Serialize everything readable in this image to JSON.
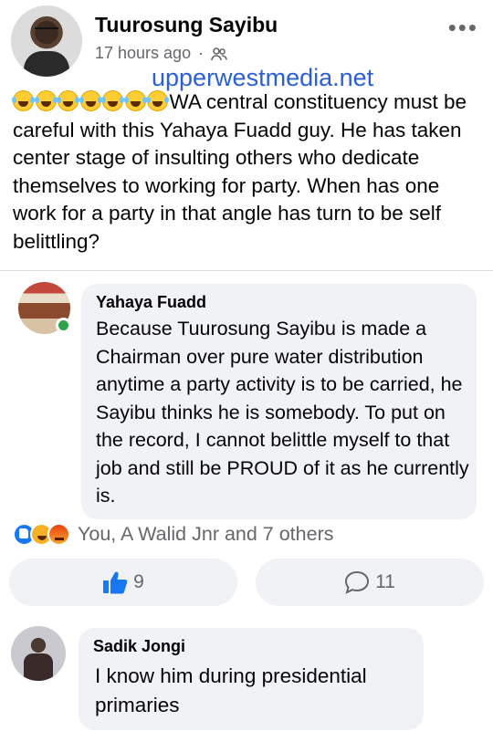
{
  "post": {
    "author": "Tuurosung Sayibu",
    "time": "17 hours ago",
    "separator": "·",
    "audience_icon": "friends-icon",
    "more_label": "•••",
    "watermark": "upperwestmedia.net",
    "emoji_count": 7,
    "emoji_icon": "tears-of-joy-emoji",
    "text": "WA central constituency must be careful with this Yahaya Fuadd guy. He has taken center stage  of insulting others who dedicate themselves to working for party. When has one work for a party in that angle has turn to be self belittling?"
  },
  "comment1": {
    "author": "Yahaya Fuadd",
    "online": true,
    "text": "Because Tuurosung Sayibu is made a Chairman over pure water distribution anytime a party activity is to be carried, he Sayibu thinks he is somebody. To put on the record, I cannot belittle myself to that job and still be PROUD of it as he currently is."
  },
  "reactions": {
    "types": [
      "like",
      "haha",
      "angry"
    ],
    "summary": "You, A Walid Jnr and 7 others"
  },
  "actions": {
    "like_count": "9",
    "comment_count": "11"
  },
  "comment2": {
    "author": "Sadik Jongi",
    "text": "I know him during presidential primaries"
  },
  "colors": {
    "link_blue": "#2b5fd9",
    "facebook_blue": "#1877f2",
    "muted": "#65676b",
    "bubble_bg": "#f0f2f5",
    "online_green": "#31a24c"
  }
}
